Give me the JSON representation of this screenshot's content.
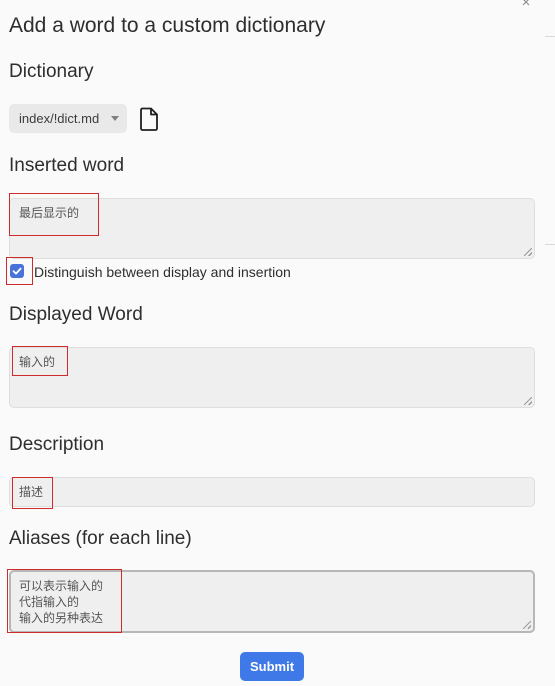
{
  "dialog": {
    "title": "Add a word to a custom dictionary",
    "close_label": "×"
  },
  "dictionary": {
    "label": "Dictionary",
    "selected": "index/!dict.md",
    "icon": "file-icon"
  },
  "inserted_word": {
    "label": "Inserted word",
    "value": "最后显示的"
  },
  "distinguish": {
    "label": "Distinguish between display and insertion",
    "checked": true
  },
  "displayed_word": {
    "label": "Displayed Word",
    "value": "输入的"
  },
  "description": {
    "label": "Description",
    "value": "描述"
  },
  "aliases": {
    "label": "Aliases (for each line)",
    "lines": [
      "可以表示输入的",
      "代指输入的",
      "输入的另种表达"
    ]
  },
  "submit_label": "Submit",
  "colors": {
    "accent": "#3f79e8",
    "highlight_box": "#cf2b2b"
  }
}
